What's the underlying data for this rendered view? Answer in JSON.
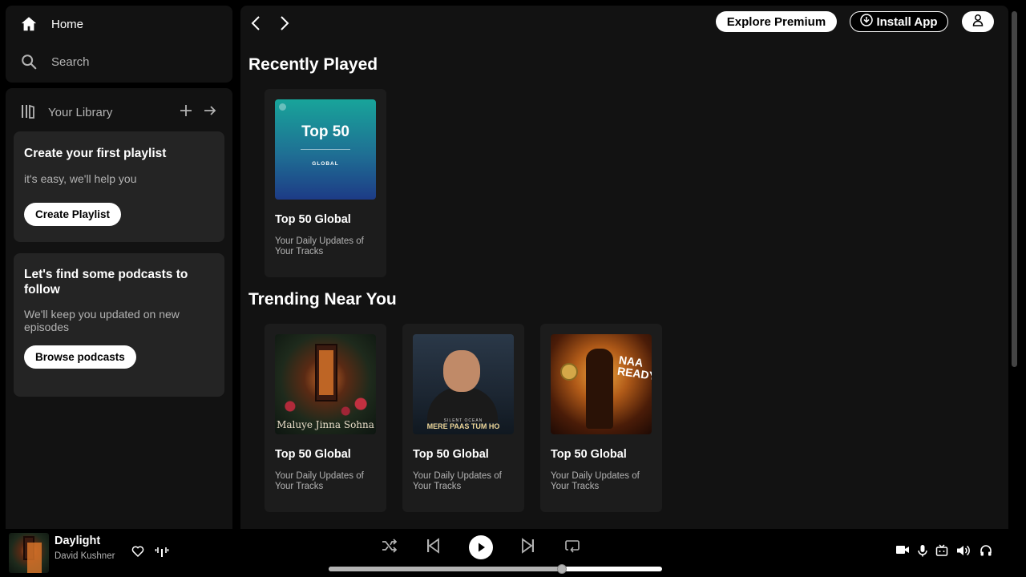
{
  "sidebar": {
    "nav": {
      "home": "Home",
      "search": "Search"
    },
    "library": {
      "title": "Your Library"
    },
    "playlist_card": {
      "title": "Create your first playlist",
      "subtitle": "it's easy, we'll help you",
      "button": "Create Playlist"
    },
    "podcast_card": {
      "title": "Let's find some podcasts to follow",
      "subtitle": "We'll keep you updated on new episodes",
      "button": "Browse podcasts"
    }
  },
  "topbar": {
    "premium": "Explore Premium",
    "install": "Install App"
  },
  "sections": {
    "recent": {
      "title": "Recently Played",
      "items": [
        {
          "title": "Top 50 Global",
          "desc": "Your Daily Updates of Your Tracks",
          "art": {
            "big": "Top 50",
            "small": "GLOBAL"
          }
        }
      ]
    },
    "trending": {
      "title": "Trending Near You",
      "items": [
        {
          "title": "Top 50 Global",
          "desc": "Your Daily Updates of Your Tracks",
          "art_caption": "Maluye Jinna Sohna"
        },
        {
          "title": "Top 50 Global",
          "desc": "Your Daily Updates of Your Tracks",
          "art_caption": "MERE PAAS TUM HO",
          "art_sub": "SILENT OCEAN"
        },
        {
          "title": "Top 50 Global",
          "desc": "Your Daily Updates of Your Tracks",
          "art_caption": "NAA READY"
        }
      ]
    }
  },
  "player": {
    "track": "Daylight",
    "artist": "David Kushner",
    "progress": 0.7
  },
  "colors": {
    "background": "#000000",
    "panel": "#121212",
    "card": "#242424",
    "tile": "#1c1c1c",
    "text_secondary": "#b3b3b3"
  }
}
